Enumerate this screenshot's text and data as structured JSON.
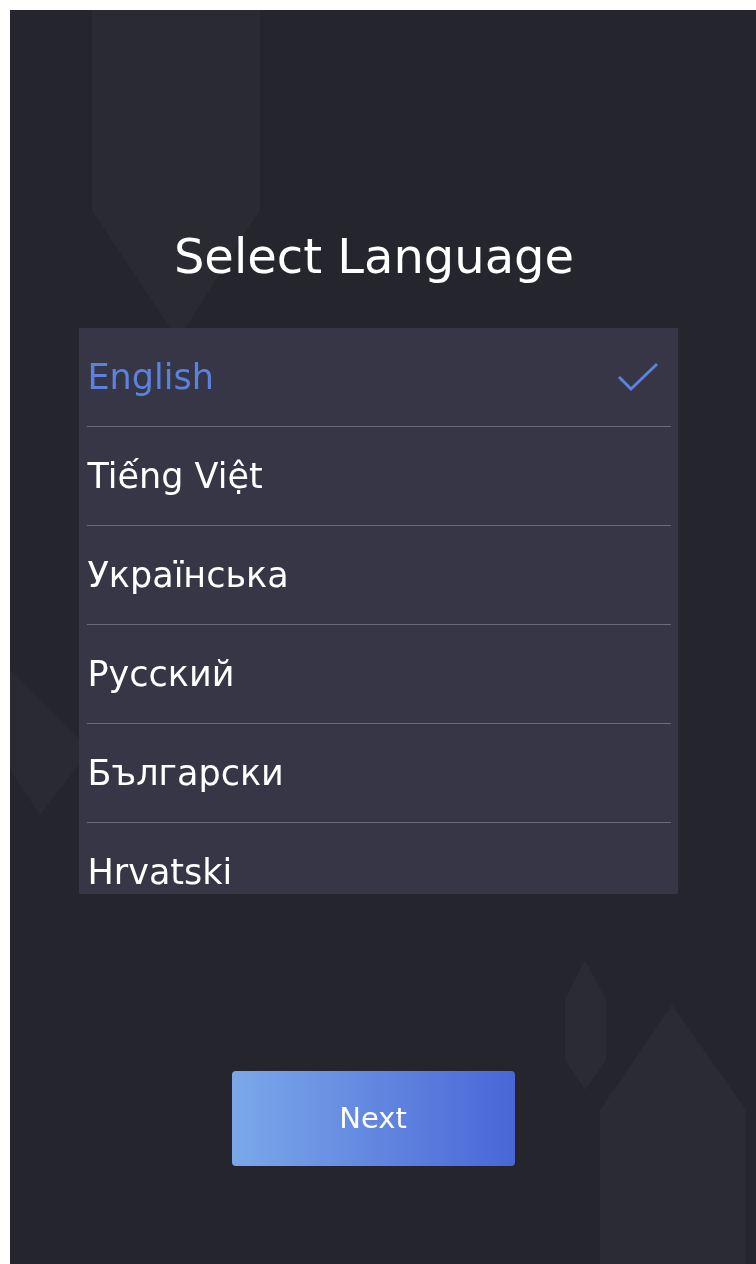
{
  "title": "Select Language",
  "languages": [
    {
      "label": "English",
      "selected": true
    },
    {
      "label": "Tiếng Việt",
      "selected": false
    },
    {
      "label": "Українська",
      "selected": false
    },
    {
      "label": "Русский",
      "selected": false
    },
    {
      "label": "Български",
      "selected": false
    },
    {
      "label": "Hrvatski",
      "selected": false
    }
  ],
  "next_button": "Next"
}
